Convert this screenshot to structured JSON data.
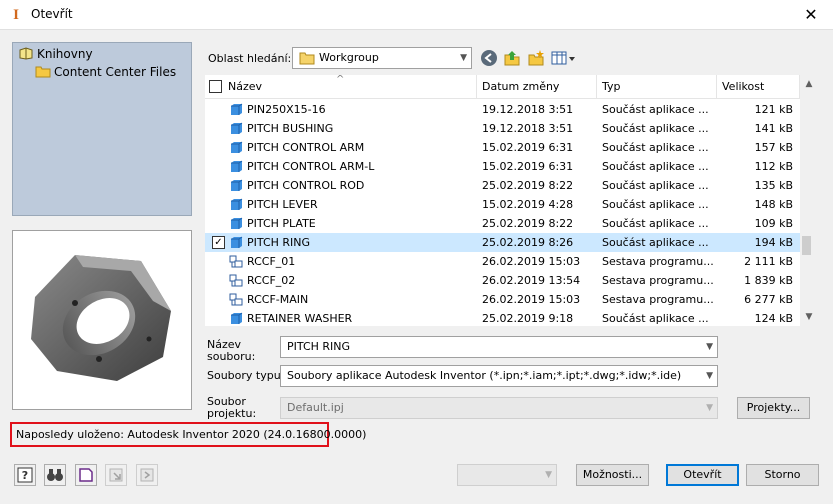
{
  "window": {
    "title": "Otevřít",
    "close_glyph": "✕"
  },
  "libraries": {
    "root": "Knihovny",
    "items": [
      "Content Center Files"
    ]
  },
  "search_area": {
    "label": "Oblast hledání:",
    "value": "Workgroup"
  },
  "columns": {
    "name": "Název",
    "date": "Datum změny",
    "type": "Typ",
    "size": "Velikost"
  },
  "files": [
    {
      "name": "PIN250X15-16",
      "date": "19.12.2018 3:51",
      "type": "Součást aplikace ...",
      "size": "121 kB",
      "kind": "part",
      "selected": false
    },
    {
      "name": "PITCH BUSHING",
      "date": "19.12.2018 3:51",
      "type": "Součást aplikace ...",
      "size": "141 kB",
      "kind": "part",
      "selected": false
    },
    {
      "name": "PITCH CONTROL ARM",
      "date": "15.02.2019 6:31",
      "type": "Součást aplikace ...",
      "size": "157 kB",
      "kind": "part",
      "selected": false
    },
    {
      "name": "PITCH CONTROL ARM-L",
      "date": "15.02.2019 6:31",
      "type": "Součást aplikace ...",
      "size": "112 kB",
      "kind": "part",
      "selected": false
    },
    {
      "name": "PITCH CONTROL ROD",
      "date": "25.02.2019 8:22",
      "type": "Součást aplikace ...",
      "size": "135 kB",
      "kind": "part",
      "selected": false
    },
    {
      "name": "PITCH LEVER",
      "date": "15.02.2019 4:28",
      "type": "Součást aplikace ...",
      "size": "148 kB",
      "kind": "part",
      "selected": false
    },
    {
      "name": "PITCH PLATE",
      "date": "25.02.2019 8:22",
      "type": "Součást aplikace ...",
      "size": "109 kB",
      "kind": "part",
      "selected": false
    },
    {
      "name": "PITCH RING",
      "date": "25.02.2019 8:26",
      "type": "Součást aplikace ...",
      "size": "194 kB",
      "kind": "part",
      "selected": true
    },
    {
      "name": "RCCF_01",
      "date": "26.02.2019 15:03",
      "type": "Sestava programu...",
      "size": "2 111 kB",
      "kind": "assembly",
      "selected": false
    },
    {
      "name": "RCCF_02",
      "date": "26.02.2019 13:54",
      "type": "Sestava programu...",
      "size": "1 839 kB",
      "kind": "assembly",
      "selected": false
    },
    {
      "name": "RCCF-MAIN",
      "date": "26.02.2019 15:03",
      "type": "Sestava programu...",
      "size": "6 277 kB",
      "kind": "assembly",
      "selected": false
    },
    {
      "name": "RETAINER WASHER",
      "date": "25.02.2019 9:18",
      "type": "Součást aplikace ...",
      "size": "124 kB",
      "kind": "part",
      "selected": false
    }
  ],
  "filename": {
    "label_line1": "Název",
    "label_line2": "souboru:",
    "value": "PITCH RING"
  },
  "filetype": {
    "label": "Soubory typu:",
    "value": "Soubory aplikace Autodesk Inventor (*.ipn;*.iam;*.ipt;*.dwg;*.idw;*.ide)"
  },
  "project": {
    "label_line1": "Soubor",
    "label_line2": "projektu:",
    "value": "Default.ipj",
    "button": "Projekty..."
  },
  "last_saved": "Naposledy uloženo: Autodesk Inventor 2020 (24.0.16800.0000)",
  "buttons": {
    "options": "Možnosti...",
    "open": "Otevřít",
    "cancel": "Storno"
  },
  "colors": {
    "selected_row": "#cce8ff",
    "library_panel": "#bdcadb",
    "highlight_border": "#e0101a",
    "accent": "#0078d7"
  }
}
